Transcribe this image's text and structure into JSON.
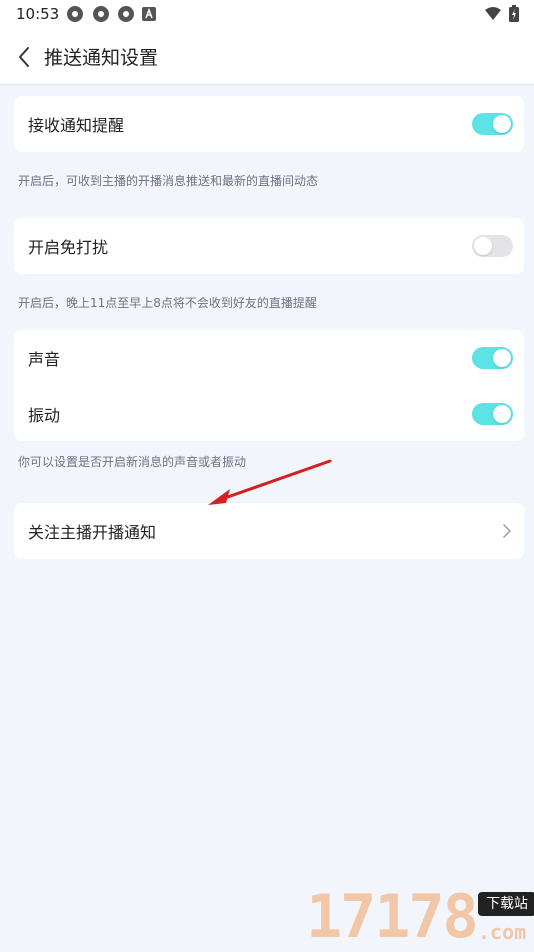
{
  "status_bar": {
    "time": "10:53",
    "icons": [
      "app-icon",
      "app-icon",
      "app-icon",
      "notification-icon",
      "wifi-icon",
      "battery-icon"
    ]
  },
  "header": {
    "back_icon": "chevron-left-icon",
    "title": "推送通知设置"
  },
  "sections": [
    {
      "rows": [
        {
          "label": "接收通知提醒",
          "toggle": true
        }
      ],
      "note": "开启后，可收到主播的开播消息推送和最新的直播间动态"
    },
    {
      "rows": [
        {
          "label": "开启免打扰",
          "toggle": false
        }
      ],
      "note": "开启后，晚上11点至早上8点将不会收到好友的直播提醒"
    },
    {
      "rows": [
        {
          "label": "声音",
          "toggle": true
        },
        {
          "label": "振动",
          "toggle": true
        }
      ],
      "note": "你可以设置是否开启新消息的声音或者振动"
    }
  ],
  "follow_row": {
    "label": "关注主播开播通知",
    "icon": "chevron-right-icon"
  },
  "colors": {
    "toggle_on": "#5be3e6",
    "toggle_off": "#e4e4e6",
    "background": "#f3f5fd",
    "annotation_arrow": "#d42020"
  },
  "watermark": {
    "digits": "17178",
    "badge": "下载站",
    "domain": ".com"
  }
}
